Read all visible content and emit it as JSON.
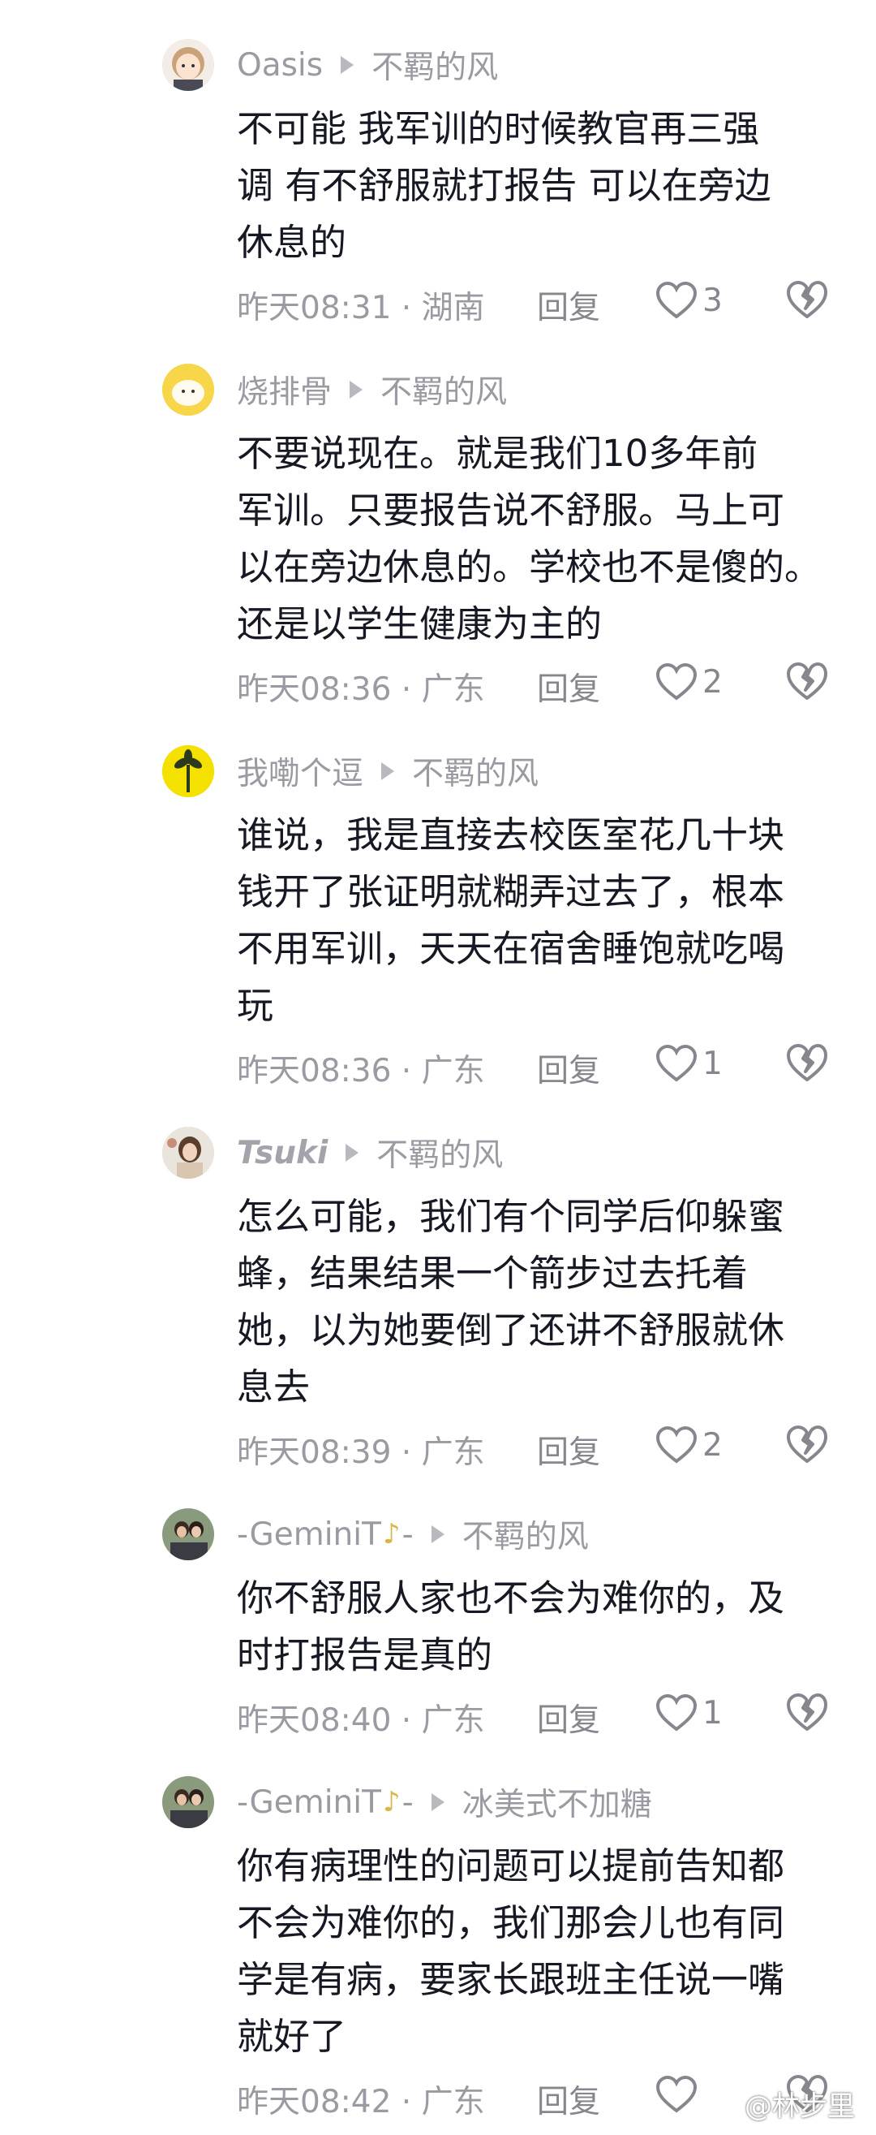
{
  "comments": [
    {
      "username": "Oasis",
      "reply_to": "不羁的风",
      "lines": [
        "不可能 我军训的时候教官再三强",
        "调 有不舒服就打报告 可以在旁边",
        "休息的"
      ],
      "time": "昨天08:31 · 湖南",
      "reply_label": "回复",
      "likes": "3",
      "avatar_icon": "cartoon-girl-avatar"
    },
    {
      "username": "烧排骨",
      "reply_to": "不羁的风",
      "lines": [
        "不要说现在。就是我们10多年前",
        "军训。只要报告说不舒服。马上可",
        "以在旁边休息的。学校也不是傻的。",
        "还是以学生健康为主的"
      ],
      "time": "昨天08:36 · 广东",
      "reply_label": "回复",
      "likes": "2",
      "avatar_icon": "yellow-bun-avatar"
    },
    {
      "username": "我嘞个逗",
      "reply_to": "不羁的风",
      "lines": [
        "谁说，我是直接去校医室花几十块",
        "钱开了张证明就糊弄过去了，根本",
        "不用军训，天天在宿舍睡饱就吃喝",
        "玩"
      ],
      "time": "昨天08:36 · 广东",
      "reply_label": "回复",
      "likes": "1",
      "avatar_icon": "yellow-plant-avatar"
    },
    {
      "username": "Tsuki",
      "reply_to": "不羁的风",
      "lines": [
        "怎么可能，我们有个同学后仰躲蜜",
        "蜂，结果结果一个箭步过去托着",
        "她，以为她要倒了还讲不舒服就休",
        "息去"
      ],
      "time": "昨天08:39 · 广东",
      "reply_label": "回复",
      "likes": "2",
      "avatar_icon": "photo-avatar"
    },
    {
      "username": "-GeminiT",
      "username_suffix": "-",
      "reply_to": "不羁的风",
      "lines": [
        "你不舒服人家也不会为难你的，及",
        "时打报告是真的"
      ],
      "time": "昨天08:40 · 广东",
      "reply_label": "回复",
      "likes": "1",
      "avatar_icon": "couple-photo-avatar"
    },
    {
      "username": "-GeminiT",
      "username_suffix": "-",
      "reply_to": "冰美式不加糖",
      "lines": [
        "你有病理性的问题可以提前告知都",
        "不会为难你的，我们那会儿也有同",
        "学是有病，要家长跟班主任说一嘴",
        "就好了"
      ],
      "time": "昨天08:42 · 广东",
      "reply_label": "回复",
      "likes": "",
      "avatar_icon": "couple-photo-avatar"
    }
  ],
  "colors": {
    "text_primary": "#161823",
    "text_secondary": "#9a9ba2",
    "accent_sax": "#d9b64a"
  },
  "watermark": "@林步里"
}
